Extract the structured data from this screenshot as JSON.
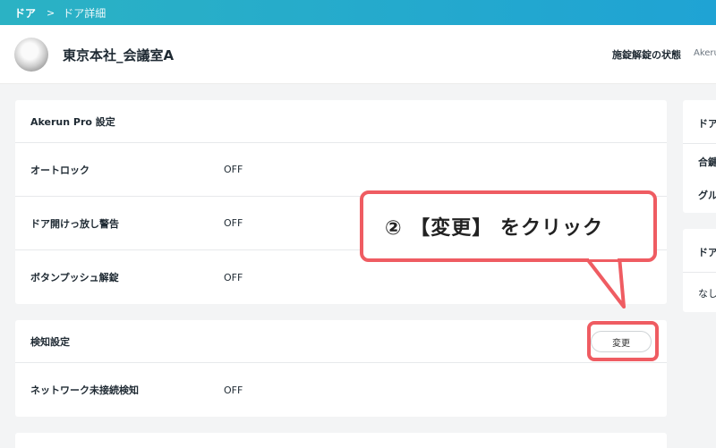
{
  "breadcrumb": {
    "root": "ドア",
    "separator": ">",
    "current": "ドア詳細"
  },
  "header": {
    "title": "東京本社_会議室A",
    "lock_state_label": "施錠解錠の状態",
    "lock_state_value": "Akerun"
  },
  "pro_settings": {
    "title": "Akerun Pro 設定",
    "rows": [
      {
        "label": "オートロック",
        "value": "OFF"
      },
      {
        "label": "ドア開けっ放し警告",
        "value": "OFF"
      },
      {
        "label": "ボタンプッシュ解錠",
        "value": "OFF"
      }
    ]
  },
  "detect_settings": {
    "title": "検知設定",
    "change_label": "変更",
    "rows": [
      {
        "label": "ネットワーク未接続検知",
        "value": "OFF"
      }
    ]
  },
  "side": {
    "card1_title": "ドア",
    "card1_item1": "合鍵",
    "card1_item2": "グル",
    "card2_title": "ドア",
    "card2_value": "なし"
  },
  "callout": {
    "text": "② 【変更】 をクリック"
  },
  "colors": {
    "accent": "#1fa3d4",
    "highlight": "#ef5c62"
  }
}
